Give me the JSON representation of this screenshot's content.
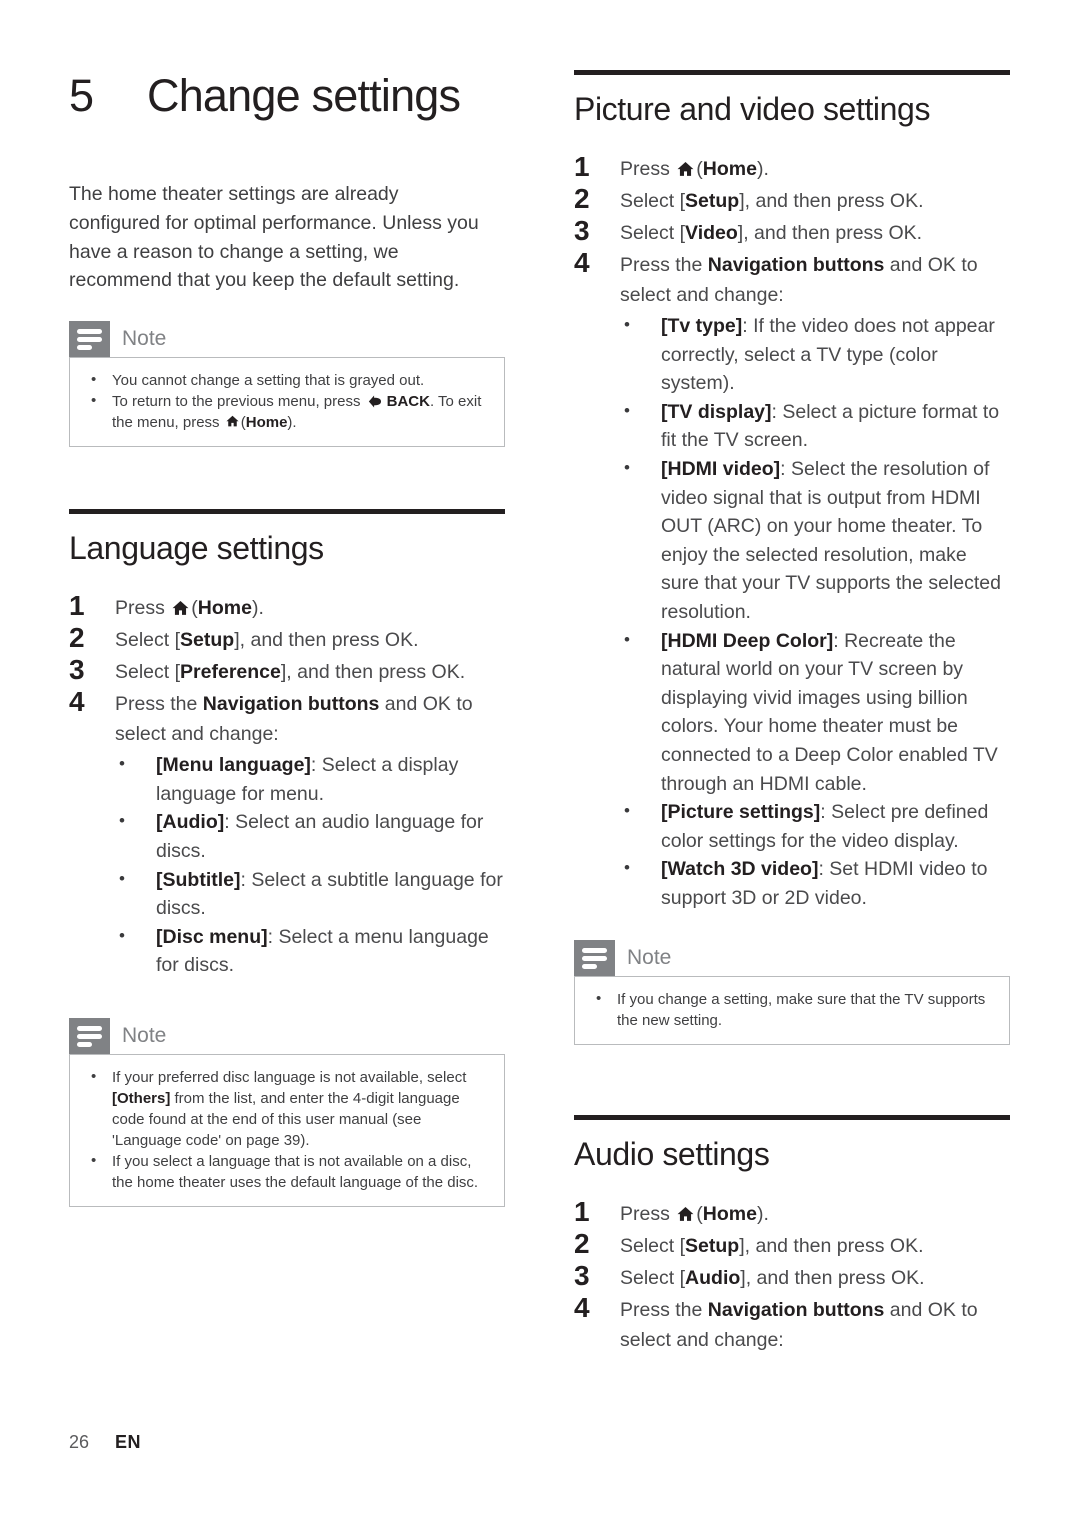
{
  "page": {
    "number": "26",
    "language_code": "EN"
  },
  "chapter": {
    "number": "5",
    "title": "Change settings",
    "intro": "The home theater settings are already configured for optimal performance. Unless you have a reason to change a setting, we recommend that you keep the default setting."
  },
  "note_label": "Note",
  "intro_note": {
    "items": [
      {
        "pre": "You cannot change a setting that is grayed out.",
        "post": ""
      },
      {
        "pre": "To return to the previous menu, press ",
        "mid_icon": "back-icon",
        "mid_strong": "BACK",
        "mid": ". To exit the menu, press ",
        "post_icon": "home-icon",
        "post_open": "(",
        "post_strong": "Home",
        "post": ")."
      }
    ]
  },
  "sections": {
    "language": {
      "title": "Language settings",
      "steps": [
        {
          "pre": "Press ",
          "icon": "home-icon",
          "mid": "(",
          "strong": "Home",
          "post": ")."
        },
        {
          "pre": "Select [",
          "strong": "Setup",
          "post": "], and then press OK."
        },
        {
          "pre": "Select [",
          "strong": "Preference",
          "post": "], and then press OK."
        },
        {
          "pre": "Press the ",
          "strong": "Navigation buttons",
          "post": " and OK to select and change:"
        }
      ],
      "bullets": [
        {
          "term": "[Menu language]",
          "desc": ": Select a display language for menu."
        },
        {
          "term": "[Audio]",
          "desc": ": Select an audio language for discs."
        },
        {
          "term": "[Subtitle]",
          "desc": ": Select a subtitle language for discs."
        },
        {
          "term": "[Disc menu]",
          "desc": ": Select a menu language for discs."
        }
      ],
      "note": {
        "items": [
          {
            "pre": "If your preferred disc language is not available, select ",
            "strong": "[Others]",
            "post": " from the list, and enter the 4-digit language code found at the end of this user manual (see 'Language code' on page 39)."
          },
          {
            "pre": "If you select a language that is not available on a disc, the home theater uses the default language of the disc.",
            "strong": "",
            "post": ""
          }
        ]
      }
    },
    "picture_video": {
      "title": "Picture and video settings",
      "steps": [
        {
          "pre": "Press ",
          "icon": "home-icon",
          "mid": "(",
          "strong": "Home",
          "post": ")."
        },
        {
          "pre": "Select [",
          "strong": "Setup",
          "post": "], and then press OK."
        },
        {
          "pre": "Select [",
          "strong": "Video",
          "post": "], and then press OK."
        },
        {
          "pre": "Press the ",
          "strong": "Navigation buttons",
          "post": " and OK to select and change:"
        }
      ],
      "bullets": [
        {
          "term": "[Tv type]",
          "desc": ": If the video does not appear correctly, select a TV type (color system)."
        },
        {
          "term": "[TV display]",
          "desc": ": Select a picture format to fit the TV screen."
        },
        {
          "term": "[HDMI video]",
          "desc": ": Select the resolution of video signal that is output from HDMI OUT (ARC) on your home theater. To enjoy the selected resolution, make sure that your TV supports the selected resolution."
        },
        {
          "term": "[HDMI Deep Color]",
          "desc": ": Recreate the natural world on your TV screen by displaying vivid images using billion colors. Your home theater must be connected to a Deep Color enabled TV through an HDMI cable."
        },
        {
          "term": "[Picture settings]",
          "desc": ": Select pre defined color settings for the video display."
        },
        {
          "term": "[Watch 3D video]",
          "desc": ": Set HDMI video to support 3D or 2D video."
        }
      ],
      "note": {
        "items": [
          {
            "pre": "If you change a setting, make sure that the TV supports the new setting.",
            "strong": "",
            "post": ""
          }
        ]
      }
    },
    "audio": {
      "title": "Audio settings",
      "steps": [
        {
          "pre": "Press ",
          "icon": "home-icon",
          "mid": "(",
          "strong": "Home",
          "post": ")."
        },
        {
          "pre": "Select [",
          "strong": "Setup",
          "post": "], and then press OK."
        },
        {
          "pre": "Select [",
          "strong": "Audio",
          "post": "], and then press OK."
        },
        {
          "pre": "Press the ",
          "strong": "Navigation buttons",
          "post": " and OK to select and change:"
        }
      ]
    }
  },
  "colors": {
    "heading": "#231f20",
    "body": "#4a4a4c",
    "note_gray": "#808285",
    "note_border": "#b9bbbd"
  }
}
